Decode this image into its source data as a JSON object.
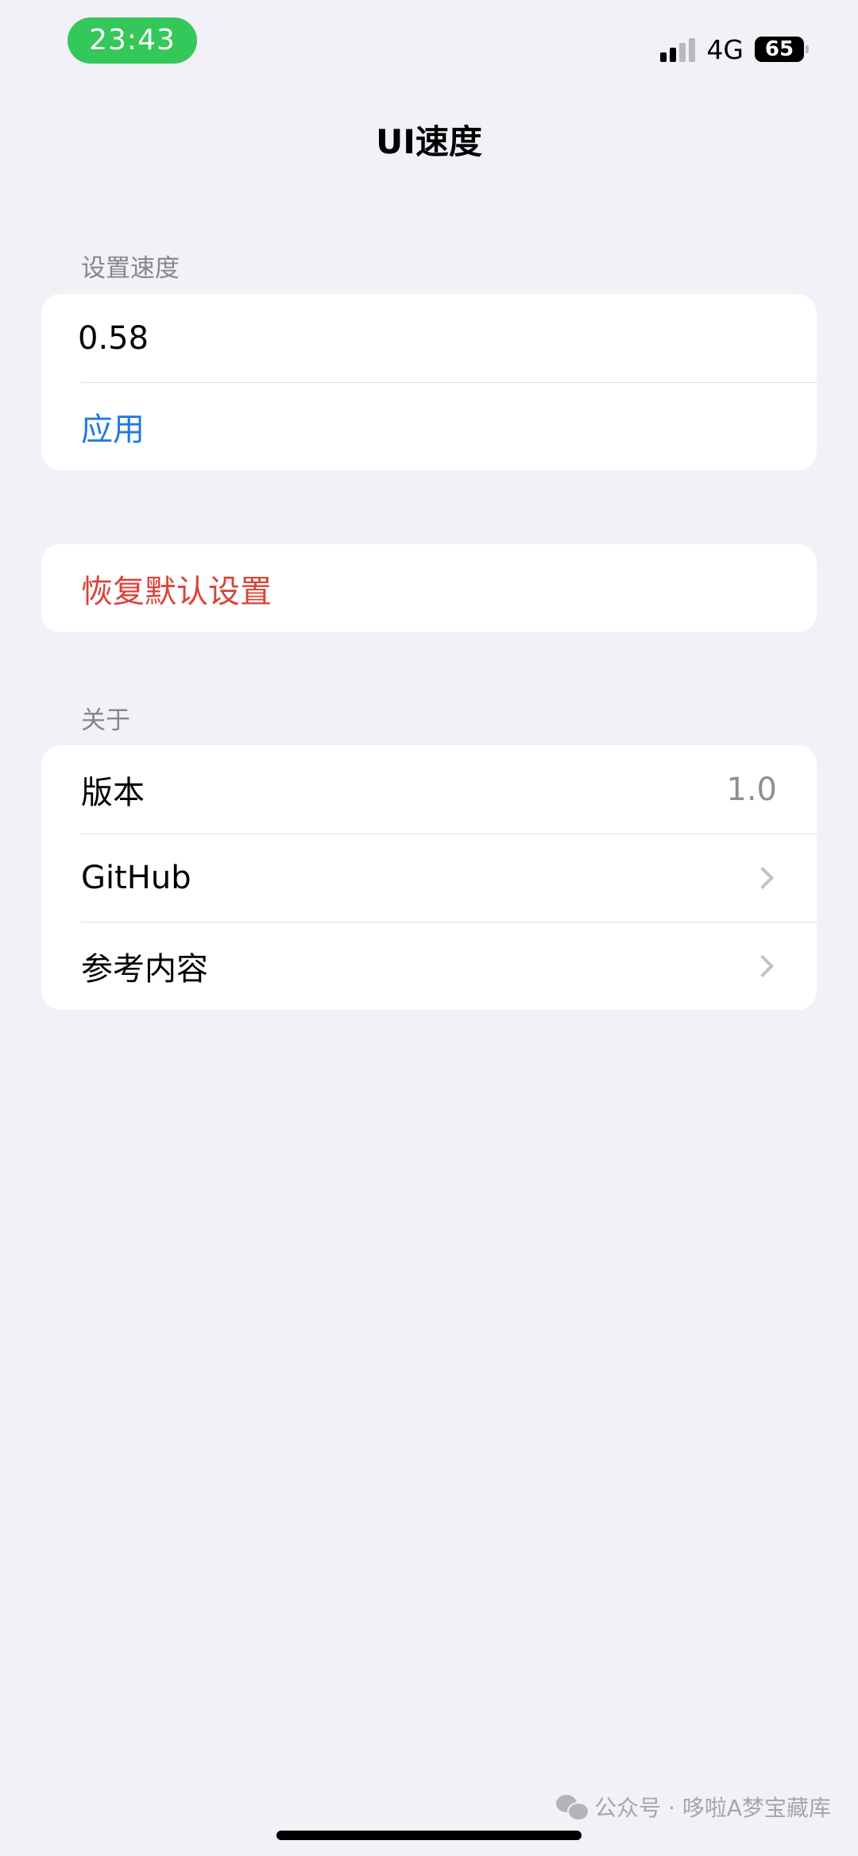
{
  "status_bar": {
    "time": "23:43",
    "network": "4G",
    "battery": "65",
    "signal_level": 2,
    "signal_max": 4
  },
  "nav": {
    "title": "UI速度"
  },
  "speed_section": {
    "header": "设置速度",
    "input_value": "0.58",
    "apply_label": "应用"
  },
  "reset": {
    "label": "恢复默认设置"
  },
  "about_section": {
    "header": "关于",
    "version_label": "版本",
    "version_value": "1.0",
    "github_label": "GitHub",
    "reference_label": "参考内容"
  },
  "watermark": {
    "text": "公众号 · 哆啦A梦宝藏库"
  },
  "colors": {
    "background": "#f2f1f7",
    "accent_blue": "#1f7ae0",
    "destructive_red": "#d8443b",
    "time_pill_green": "#34c759"
  }
}
